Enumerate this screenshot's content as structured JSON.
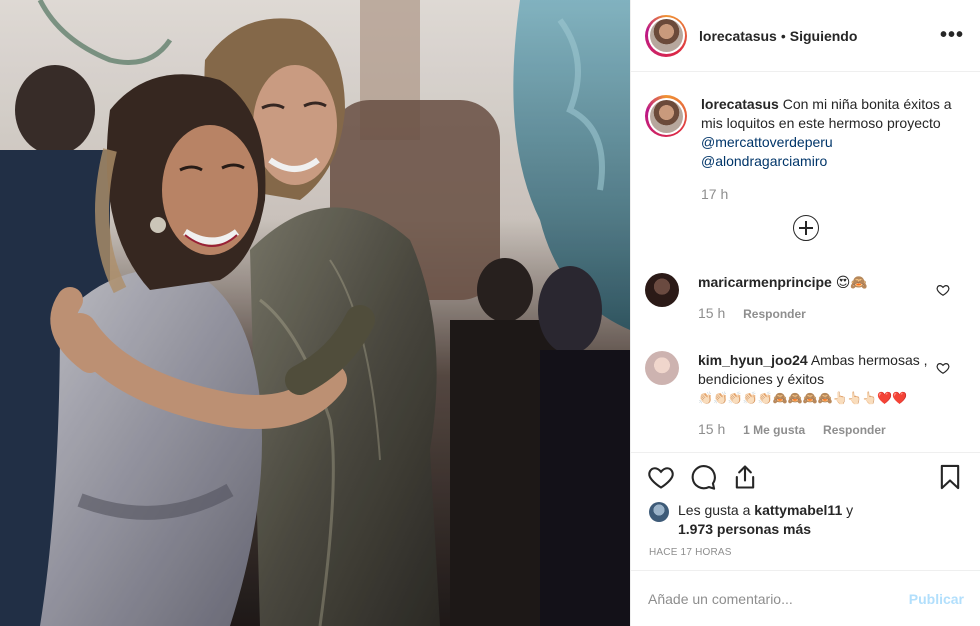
{
  "header": {
    "username": "lorecatasus",
    "separator": "•",
    "follow_status": "Siguiendo",
    "more_label": "•••"
  },
  "caption": {
    "username": "lorecatasus",
    "text": "Con mi niña bonita éxitos a mis loquitos en este hermoso proyecto",
    "mention_1": "@mercattoverdeperu",
    "mention_2": "@alondragarciamiro",
    "time": "17 h"
  },
  "comments": [
    {
      "username": "maricarmenprincipe",
      "text": "😍🙈",
      "time": "15 h",
      "reply_label": "Responder",
      "avatar_color": "#3a2420"
    },
    {
      "username": "kim_hyun_joo24",
      "text": "Ambas hermosas , bendiciones y éxitos",
      "emoji_line": "👏🏻👏🏻👏🏻👏🏻👏🏻🙈🙈🙈🙈👆🏻👆🏻👆🏻❤️❤️",
      "time": "15 h",
      "likes_label": "1 Me gusta",
      "reply_label": "Responder",
      "avatar_color": "#d9c7c3"
    }
  ],
  "likes": {
    "prefix": "Les gusta a",
    "user": "kattymabel11",
    "conjunction": "y",
    "count_text": "1.973 personas más"
  },
  "posted_ago": "HACE 17 HORAS",
  "add_comment": {
    "placeholder": "Añade un comentario...",
    "publish_label": "Publicar"
  },
  "colors": {
    "link": "#003569",
    "muted": "#8e8e8e",
    "publish_disabled": "#b2dffc",
    "heart_red": "#c0152f"
  }
}
